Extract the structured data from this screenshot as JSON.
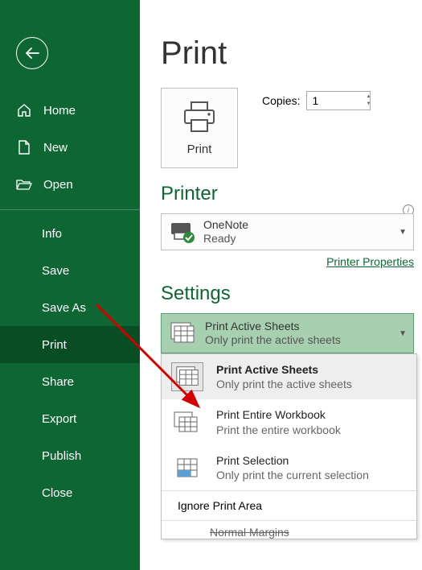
{
  "sidebar": {
    "back": "←",
    "home": "Home",
    "new": "New",
    "open": "Open",
    "items": [
      "Info",
      "Save",
      "Save As",
      "Print",
      "Share",
      "Export",
      "Publish",
      "Close"
    ],
    "active_index": 3
  },
  "main": {
    "title": "Print",
    "print_button": "Print",
    "copies_label": "Copies:",
    "copies_value": "1",
    "printer_heading": "Printer",
    "printer": {
      "name": "OneNote",
      "status": "Ready"
    },
    "printer_props": "Printer Properties",
    "settings_heading": "Settings",
    "settings_selected": {
      "title": "Print Active Sheets",
      "sub": "Only print the active sheets"
    },
    "menu": [
      {
        "title": "Print Active Sheets",
        "sub": "Only print the active sheets"
      },
      {
        "title": "Print Entire Workbook",
        "sub": "Print the entire workbook"
      },
      {
        "title": "Print Selection",
        "sub": "Only print the current selection"
      }
    ],
    "menu_footer": "Ignore Print Area",
    "menu_partial": "Normal Margins"
  }
}
